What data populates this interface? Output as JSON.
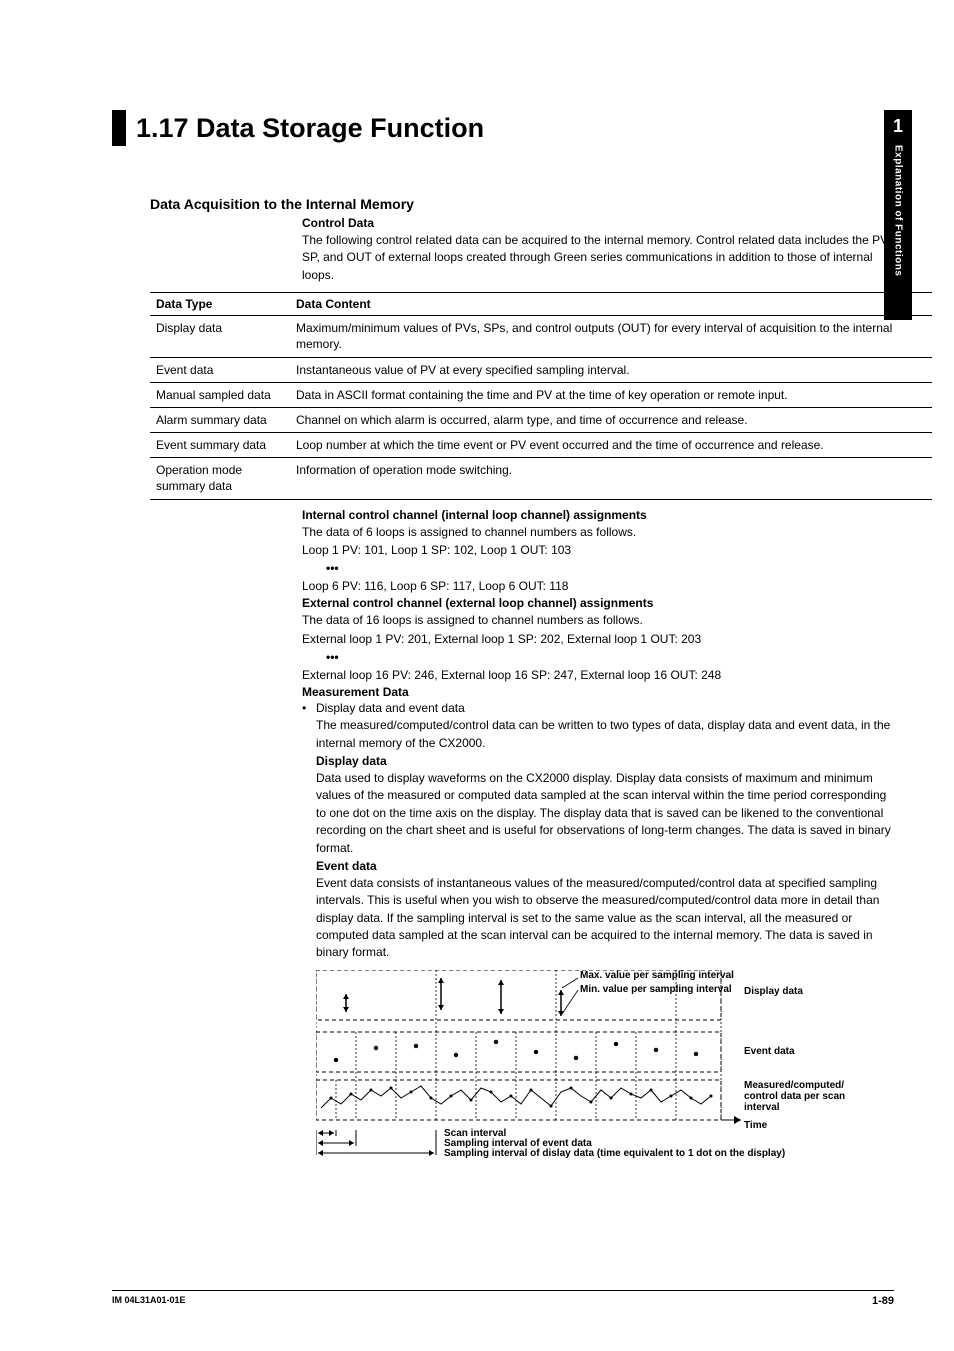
{
  "side_tab": {
    "chapter_num": "1",
    "label": "Explanation of Functions"
  },
  "title": "1.17  Data Storage Function",
  "section1": {
    "heading": "Data Acquisition to the Internal Memory",
    "sub_b": "Control Data",
    "intro": "The following control related data can be acquired to the internal memory.  Control related data includes the PV, SP, and OUT of external loops created through Green series communications in addition to those of internal loops."
  },
  "table": {
    "head_type": "Data Type",
    "head_content": "Data Content",
    "rows": [
      {
        "t": "Display data",
        "c": "Maximum/minimum values of PVs, SPs, and control outputs (OUT) for every interval of acquisition to the internal memory."
      },
      {
        "t": "Event data",
        "c": "Instantaneous value of PV at every specified sampling interval."
      },
      {
        "t": "Manual sampled data",
        "c": "Data in ASCII format containing the time and PV at the time of key operation or remote input."
      },
      {
        "t": "Alarm summary data",
        "c": "Channel on which alarm is occurred, alarm type, and time of occurrence and release."
      },
      {
        "t": "Event summary data",
        "c": "Loop number at which the time event or PV event occurred and the time of occurrence and release."
      },
      {
        "t": "Operation mode summary data",
        "c": "Information of operation mode switching."
      }
    ]
  },
  "internal": {
    "heading": "Internal control channel (internal loop channel) assignments",
    "line1": "The data of 6 loops is assigned to channel numbers as follows.",
    "line2": "Loop 1 PV: 101, Loop 1 SP: 102, Loop 1 OUT: 103",
    "dots": "•••",
    "line3": "Loop 6 PV: 116, Loop 6 SP: 117, Loop 6 OUT: 118"
  },
  "external": {
    "heading": "External control channel (external loop channel) assignments",
    "line1": "The data of 16 loops is assigned to channel numbers as follows.",
    "line2": "External loop 1 PV: 201, External loop 1 SP: 202, External loop 1 OUT: 203",
    "dots": "•••",
    "line3": "External loop 16 PV: 246, External loop 16 SP: 247, External loop 16 OUT: 248"
  },
  "measurement": {
    "heading": "Measurement Data",
    "bullet": "Display data and event data",
    "bullet_desc": "The measured/computed/control data can be written to two types of data, display data and event data, in the internal memory of the CX2000.",
    "display_h": "Display data",
    "display_p": "Data used to display waveforms on the CX2000 display.  Display data consists of maximum and minimum values of the measured or computed data sampled at the scan interval within the time period corresponding to one dot on the time axis on the display.  The display data that is saved can be likened to the conventional recording on the chart sheet and is useful for observations of long-term changes.  The data is saved in binary format.",
    "event_h": "Event data",
    "event_p": "Event data consists of instantaneous values of the measured/computed/control data at specified sampling intervals.  This is useful when you wish to observe the measured/computed/control data more in detail than display data.  If the sampling interval is set to the same value as the scan interval, all the measured or computed data sampled at the scan interval can be acquired to the internal memory.  The data is saved in binary format."
  },
  "diagram": {
    "lbl_max": "Max. value per sampling interval",
    "lbl_min": "Min. value per sampling interval",
    "lbl_display": "Display data",
    "lbl_event": "Event data",
    "lbl_mcc": "Measured/computed/\ncontrol data per scan\ninterval",
    "lbl_time": "Time",
    "lbl_scan": "Scan interval",
    "lbl_samp_ev": "Sampling interval of event data",
    "lbl_samp_disp": "Sampling interval of dislay data (time equivalent to 1 dot on the display)"
  },
  "footer": {
    "left": "IM 04L31A01-01E",
    "right": "1-89"
  }
}
